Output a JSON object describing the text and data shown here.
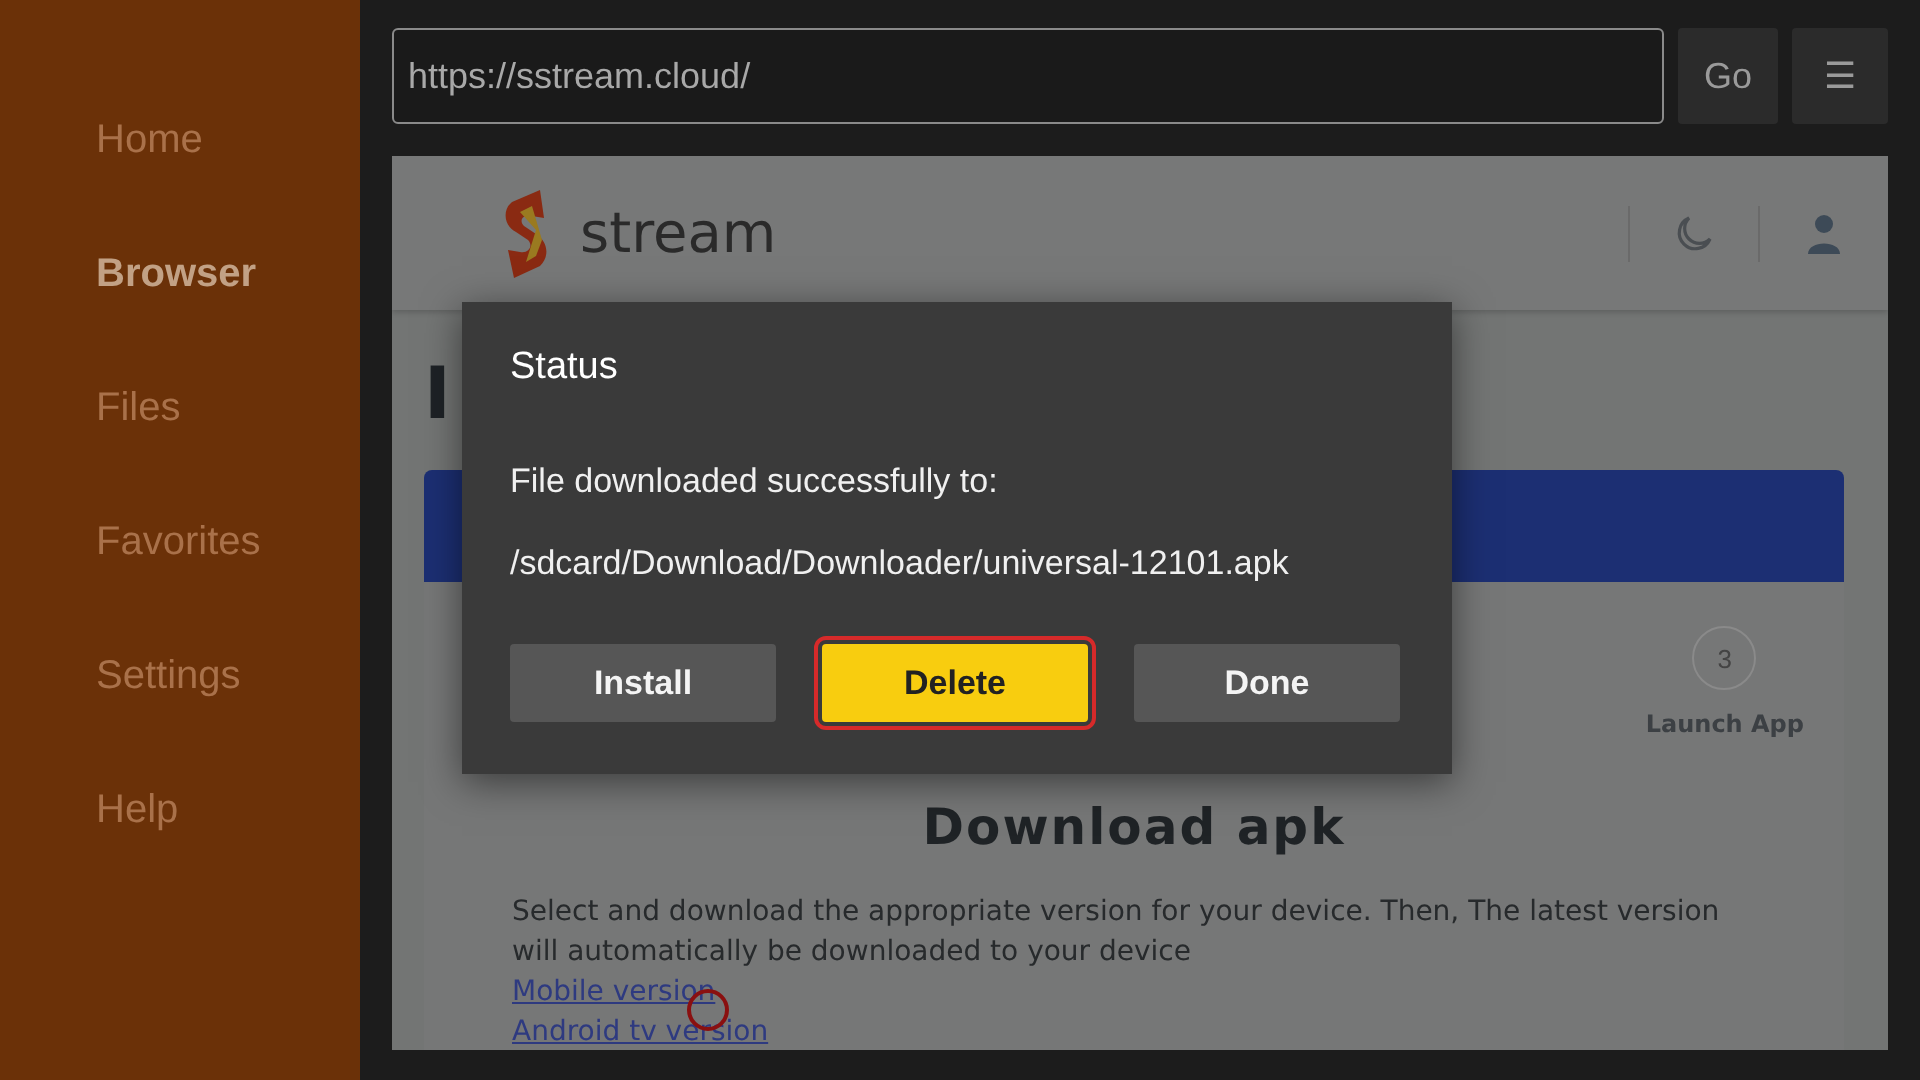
{
  "sidebar": {
    "items": [
      {
        "label": "Home",
        "selected": false
      },
      {
        "label": "Browser",
        "selected": true
      },
      {
        "label": "Files",
        "selected": false
      },
      {
        "label": "Favorites",
        "selected": false
      },
      {
        "label": "Settings",
        "selected": false
      },
      {
        "label": "Help",
        "selected": false
      }
    ]
  },
  "address_bar": {
    "value": "https://sstream.cloud/",
    "go_label": "Go",
    "menu_label": "☰"
  },
  "web_page": {
    "site_name": "stream",
    "heading_fragment": "I",
    "steps": {
      "last_step_number": "3",
      "last_step_label": "Launch App"
    },
    "section_title": "Download apk",
    "description": "Select and download the appropriate version for your device. Then, The latest version will automatically be downloaded to your device",
    "links": [
      "Mobile version",
      "Android tv version"
    ]
  },
  "dialog": {
    "title": "Status",
    "message": "File downloaded successfully to:",
    "path": "/sdcard/Download/Downloader/universal-12101.apk",
    "buttons": [
      {
        "label": "Install",
        "selected": false
      },
      {
        "label": "Delete",
        "selected": true
      },
      {
        "label": "Done",
        "selected": false
      }
    ]
  }
}
